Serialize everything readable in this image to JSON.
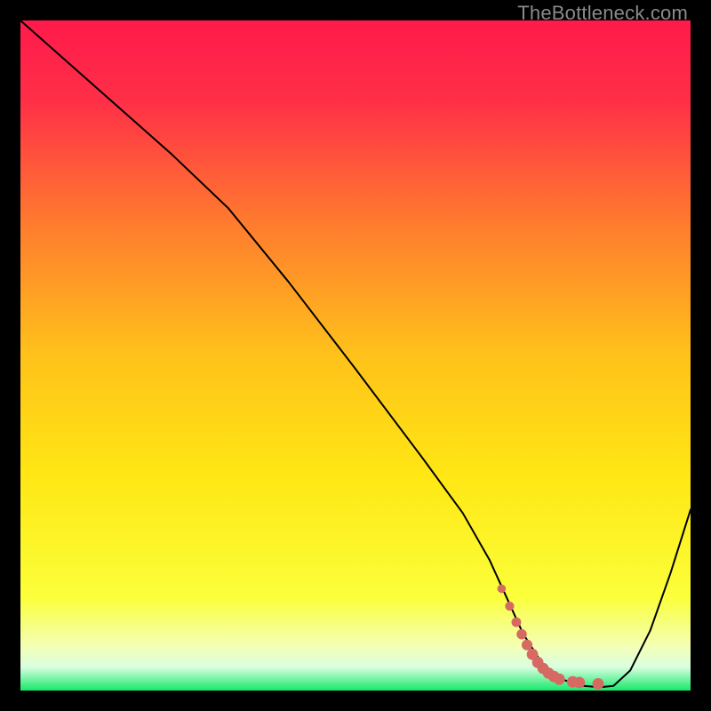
{
  "watermark": "TheBottleneck.com",
  "chart_data": {
    "type": "line",
    "title": "",
    "xlabel": "",
    "ylabel": "",
    "xlim": [
      0,
      100
    ],
    "ylim": [
      0,
      100
    ],
    "background_gradient": {
      "stops": [
        {
          "offset": 0.0,
          "color": "#ff1a4b"
        },
        {
          "offset": 0.12,
          "color": "#ff2f47"
        },
        {
          "offset": 0.3,
          "color": "#ff7a2f"
        },
        {
          "offset": 0.5,
          "color": "#ffc21a"
        },
        {
          "offset": 0.68,
          "color": "#ffe714"
        },
        {
          "offset": 0.86,
          "color": "#fbff3a"
        },
        {
          "offset": 0.935,
          "color": "#f3ffb7"
        },
        {
          "offset": 0.965,
          "color": "#d8ffe0"
        },
        {
          "offset": 1.0,
          "color": "#17e86a"
        }
      ]
    },
    "series": [
      {
        "name": "bottleneck-curve",
        "stroke": "#000000",
        "stroke_width": 2,
        "x": [
          0.0,
          13.0,
          22.6,
          31.0,
          40.0,
          50.0,
          60.0,
          66.0,
          70.0,
          72.5,
          75.0,
          78.0,
          81.0,
          84.0,
          86.5,
          88.5,
          91.0,
          94.0,
          97.0,
          100.0
        ],
        "y": [
          100.0,
          88.5,
          80.0,
          72.0,
          61.0,
          48.0,
          34.7,
          26.5,
          19.5,
          14.0,
          8.5,
          3.8,
          1.6,
          0.7,
          0.5,
          0.7,
          3.0,
          9.0,
          17.5,
          27.0
        ]
      }
    ],
    "markers": {
      "name": "highlight-points",
      "color": "#d66a62",
      "points": [
        {
          "x": 71.8,
          "y": 15.2,
          "r": 3.0
        },
        {
          "x": 73.0,
          "y": 12.6,
          "r": 3.2
        },
        {
          "x": 74.0,
          "y": 10.2,
          "r": 3.4
        },
        {
          "x": 74.8,
          "y": 8.4,
          "r": 3.6
        },
        {
          "x": 75.6,
          "y": 6.8,
          "r": 3.8
        },
        {
          "x": 76.4,
          "y": 5.4,
          "r": 4.0
        },
        {
          "x": 77.2,
          "y": 4.2,
          "r": 4.0
        },
        {
          "x": 78.0,
          "y": 3.3,
          "r": 4.0
        },
        {
          "x": 78.8,
          "y": 2.6,
          "r": 4.0
        },
        {
          "x": 79.6,
          "y": 2.1,
          "r": 4.0
        },
        {
          "x": 80.4,
          "y": 1.7,
          "r": 4.0
        },
        {
          "x": 82.4,
          "y": 1.3,
          "r": 4.0
        },
        {
          "x": 83.4,
          "y": 1.2,
          "r": 4.0
        },
        {
          "x": 86.2,
          "y": 1.0,
          "r": 4.0
        }
      ]
    }
  }
}
